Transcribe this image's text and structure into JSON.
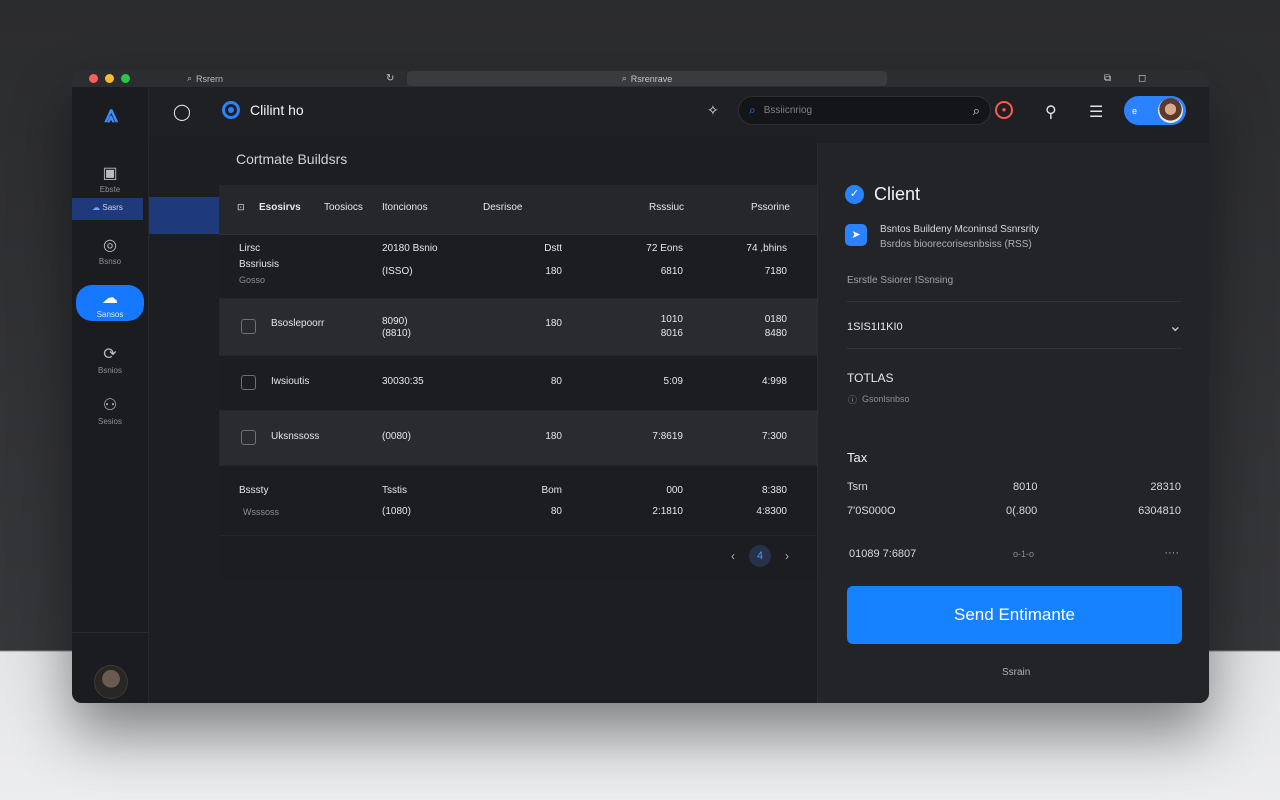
{
  "browser": {
    "tab_label": "Rsrern",
    "url": "Rsrenrave"
  },
  "sidebar": {
    "items": [
      {
        "label": "Ebste",
        "icon": "document-icon"
      },
      {
        "label": "Sasrs",
        "icon": "cloud-icon"
      },
      {
        "label": "Bsnso",
        "icon": "chat-icon"
      },
      {
        "label": "Sansos",
        "icon": "cloud-upload-icon"
      },
      {
        "label": "Bsnios",
        "icon": "refresh-icon"
      },
      {
        "label": "Sesios",
        "icon": "group-icon"
      }
    ]
  },
  "topbar": {
    "breadcrumb": "Clilint ho",
    "search_placeholder": "Bssiicnriog",
    "user_initial": "e"
  },
  "main": {
    "title": "Cortmate Buildsrs",
    "headers": [
      "Esosirvs",
      "Toosiocs",
      "Itoncionos",
      "Desrisoe",
      "Rsssiuc",
      "Pssorine"
    ],
    "rows": [
      {
        "c1": "Lirsc",
        "c1b": "Bssriusis",
        "c1c": "Gosso",
        "c2": "20180 Bsnio",
        "c2b": "(ISSO)",
        "c3": "Dstt",
        "c3b": "180",
        "c4": "72 Eons",
        "c4b": "6810",
        "c5": "74 ,bhins",
        "c5b": "7180"
      },
      {
        "c1": "Bsoslepoorr",
        "c2": "8090)",
        "c2b": "(8810)",
        "c3": "180",
        "c4": "1010",
        "c4b": "8016",
        "c5": "0180",
        "c5b": "8480"
      },
      {
        "c1": "Iwsioutis",
        "c2": "30030:35",
        "c3": "80",
        "c4": "5:09",
        "c5": "4:998"
      },
      {
        "c1": "Uksnssoss",
        "c2": "(0080)",
        "c3": "180",
        "c4": "7:8619",
        "c5": "7:300"
      },
      {
        "c1": "Bsssty",
        "c1b": "Wsssoss",
        "c2": "Tsstis",
        "c2b": "(1080)",
        "c3": "Bom",
        "c3b": "80",
        "c4": "000",
        "c4b": "2:1810",
        "c5": "8:380",
        "c5b": "4:8300"
      }
    ],
    "pager_current": "4"
  },
  "panel": {
    "title": "Client",
    "client_line1": "Bsntos Buildeny Mconinsd Ssnrsrity",
    "client_line2": "Bsrdos bioorecorisesnbsiss (RSS)",
    "section_label": "Esrstle Ssiorer ISsnsing",
    "dropdown_value": "1SIS1I1KI0",
    "totals_label": "TOTLAS",
    "totals_sub": "Gsonlsnbso",
    "tax_label": "Tax",
    "tax_rows": [
      {
        "a": "Tsrn",
        "b": "8010",
        "c": "28310"
      },
      {
        "a": "7'0S000O",
        "b": "0(.800",
        "c": "6304810"
      },
      {
        "a": "01089 7:6807",
        "b": "o-1-o",
        "c": "····"
      }
    ],
    "send_button": "Send Entimante",
    "cancel_link": "Ssrain"
  }
}
